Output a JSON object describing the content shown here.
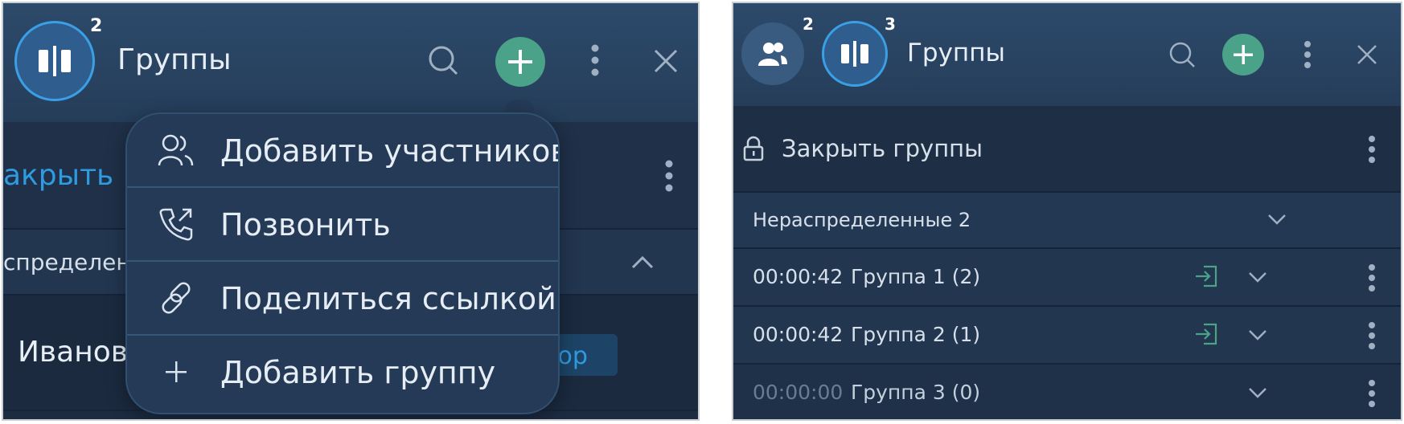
{
  "left": {
    "header": {
      "title": "Группы",
      "badge": "2"
    },
    "bg_rows": {
      "close_partial": "акрыть гр",
      "unassigned_partial": "спределен",
      "member_partial": "Иванов",
      "role_partial": "тор"
    },
    "menu": {
      "items": [
        {
          "label": "Добавить участников",
          "icon": "users-icon"
        },
        {
          "label": "Позвонить",
          "icon": "phone-icon"
        },
        {
          "label": "Поделиться ссылкой",
          "icon": "link-icon"
        },
        {
          "label": "Добавить группу",
          "icon": "plus-icon"
        }
      ]
    }
  },
  "right": {
    "header": {
      "title": "Группы",
      "badge_users": "2",
      "badge_groups": "3"
    },
    "close_groups": "Закрыть группы",
    "unassigned": "Нераспределенные 2",
    "groups": [
      {
        "time": "00:00:42",
        "name": "Группа 1 (2)",
        "join": true
      },
      {
        "time": "00:00:42",
        "name": "Группа 2 (1)",
        "join": true
      },
      {
        "time": "00:00:00",
        "name": "Группа 3 (0)",
        "join": false
      }
    ]
  },
  "colors": {
    "accent_green": "#4aa389",
    "accent_blue": "#3aa0e6",
    "dim_text": "#6a7c91"
  }
}
